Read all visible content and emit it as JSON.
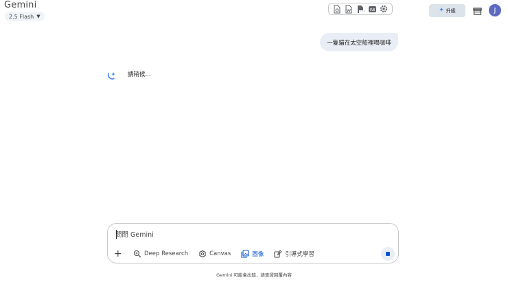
{
  "header": {
    "app_title": "Gemini",
    "model": "2.5 Flash",
    "upgrade_label": "升級",
    "avatar_initial": "J"
  },
  "toolbar": {
    "icons": [
      "google-docs-icon",
      "word-doc-icon",
      "pdf-icon",
      "captions-icon",
      "settings-icon"
    ]
  },
  "chat": {
    "user_message": "一隻貓在太空船裡喝咖啡",
    "thinking_text": "請稍候..."
  },
  "input": {
    "placeholder": "問問 Gemini",
    "tools": [
      {
        "label": "Deep Research"
      },
      {
        "label": "Canvas"
      },
      {
        "label": "圖像"
      },
      {
        "label": "引導式學習"
      }
    ]
  },
  "footer": {
    "disclaimer": "Gemini 可能會出錯，請查證回覆內容"
  },
  "colors": {
    "accent": "#0b57d0",
    "bubble": "#e9eef6",
    "upgrade_bg": "#dde3ea",
    "avatar": "#5c6bc0"
  }
}
